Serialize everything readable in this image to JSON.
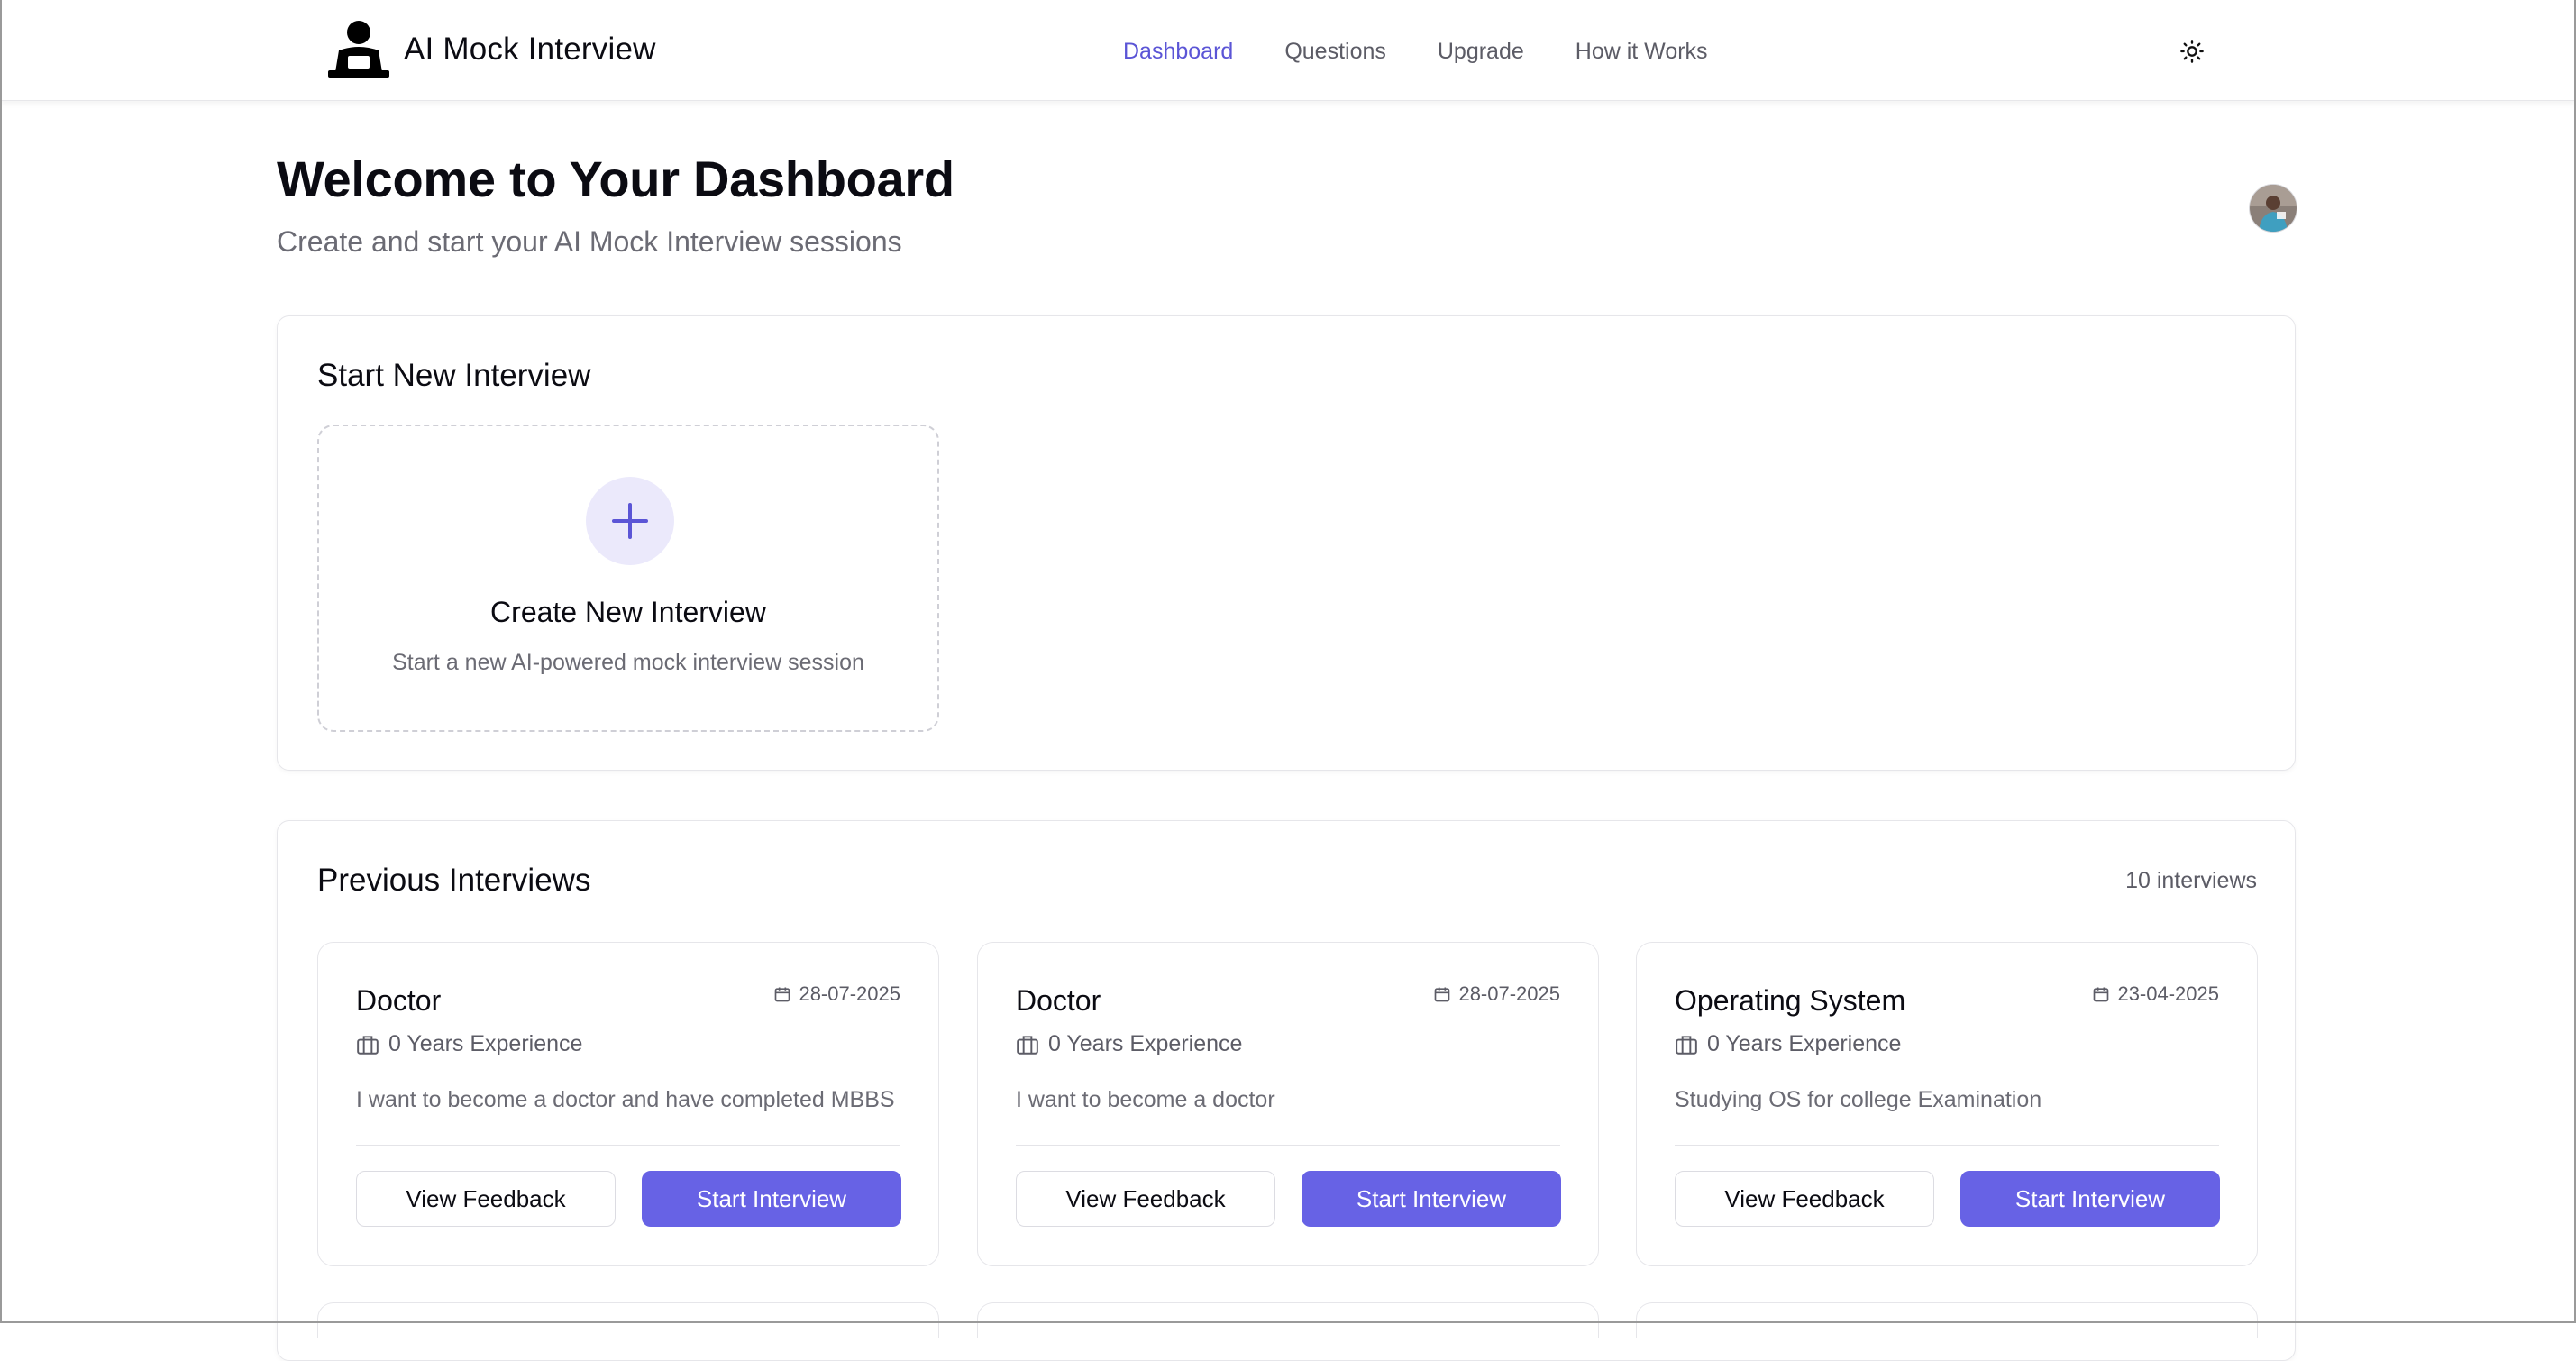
{
  "header": {
    "brand_name": "AI Mock Interview",
    "nav": [
      {
        "label": "Dashboard",
        "active": true
      },
      {
        "label": "Questions",
        "active": false
      },
      {
        "label": "Upgrade",
        "active": false
      },
      {
        "label": "How it Works",
        "active": false
      }
    ],
    "theme_icon": "sun-icon"
  },
  "main": {
    "title": "Welcome to Your Dashboard",
    "subtitle": "Create and start your AI Mock Interview sessions",
    "new_interview": {
      "heading": "Start New Interview",
      "card_title": "Create New Interview",
      "card_description": "Start a new AI-powered mock interview session"
    },
    "previous": {
      "heading": "Previous Interviews",
      "count": "10 interviews",
      "cards": [
        {
          "title": "Doctor",
          "date": "28-07-2025",
          "experience": "0 Years Experience",
          "description": "I want to become a doctor and have completed MBBS",
          "feedback_label": "View Feedback",
          "start_label": "Start Interview"
        },
        {
          "title": "Doctor",
          "date": "28-07-2025",
          "experience": "0 Years Experience",
          "description": "I want to become a doctor",
          "feedback_label": "View Feedback",
          "start_label": "Start Interview"
        },
        {
          "title": "Operating System",
          "date": "23-04-2025",
          "experience": "0 Years Experience",
          "description": "Studying OS for college Examination",
          "feedback_label": "View Feedback",
          "start_label": "Start Interview"
        }
      ]
    }
  },
  "colors": {
    "accent": "#6762e5",
    "nav_active": "#5b55d6",
    "plus_bg": "#ebe9fb"
  }
}
